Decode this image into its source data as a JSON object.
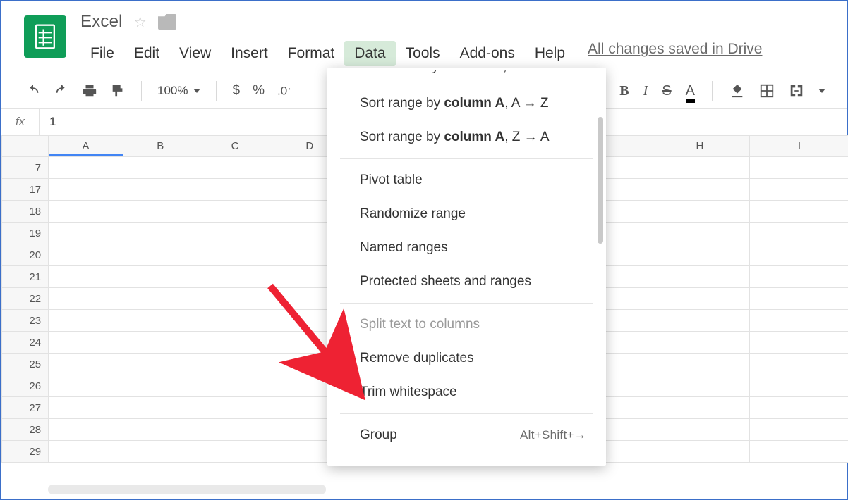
{
  "doc": {
    "title": "Excel",
    "save_note": "All changes saved in Drive"
  },
  "menus": {
    "file": "File",
    "edit": "Edit",
    "view": "View",
    "insert": "Insert",
    "format": "Format",
    "data": "Data",
    "tools": "Tools",
    "addons": "Add-ons",
    "help": "Help"
  },
  "toolbar": {
    "zoom": "100%",
    "currency": "$",
    "percent": "%",
    "dec_less": ".0",
    "bold": "B",
    "italic": "I",
    "strike": "S",
    "textcolor": "A"
  },
  "formula": {
    "fx": "fx",
    "value": "1"
  },
  "columns": [
    "A",
    "B",
    "C",
    "D",
    "",
    "",
    "",
    "H",
    "I"
  ],
  "rows": [
    "7",
    "17",
    "18",
    "19",
    "20",
    "21",
    "22",
    "23",
    "24",
    "25",
    "26",
    "27",
    "28",
    "29"
  ],
  "data_menu": {
    "cut_top": {
      "pre": "Sort sheet by ",
      "bold": "column A",
      "post": ", Z → A"
    },
    "sort_range_az": {
      "pre": "Sort range by ",
      "bold": "column A",
      "post": ", A → Z"
    },
    "sort_range_za": {
      "pre": "Sort range by ",
      "bold": "column A",
      "post": ", Z → A"
    },
    "pivot": "Pivot table",
    "randomize": "Randomize range",
    "named": "Named ranges",
    "protected": "Protected sheets and ranges",
    "split": "Split text to columns",
    "remove_dup": "Remove duplicates",
    "trim": "Trim whitespace",
    "group": "Group",
    "group_sc": "Alt+Shift+→"
  }
}
